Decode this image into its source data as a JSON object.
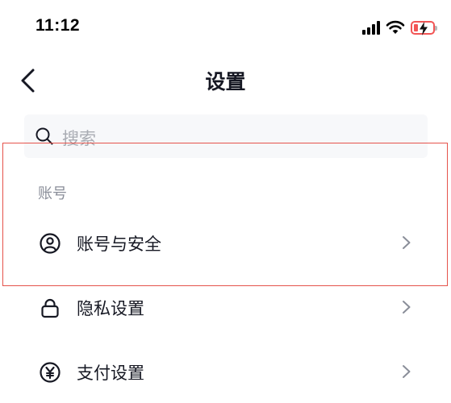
{
  "status_bar": {
    "time": "11:12",
    "icons": [
      "cellular-signal-icon",
      "wifi-icon",
      "battery-charging-icon"
    ],
    "battery_color": "#f25555"
  },
  "nav": {
    "title": "设置",
    "back_icon": "chevron-left-icon"
  },
  "search": {
    "placeholder": "搜索",
    "icon": "search-icon"
  },
  "sections": [
    {
      "header": "账号",
      "items": [
        {
          "label": "账号与安全",
          "icon": "user-circle-icon"
        },
        {
          "label": "隐私设置",
          "icon": "lock-icon"
        },
        {
          "label": "支付设置",
          "icon": "yen-circle-icon"
        }
      ]
    }
  ],
  "colors": {
    "highlight": "#e5534b",
    "text_primary": "#161823",
    "text_secondary": "#8a8e99",
    "search_bg": "#f7f8fa"
  }
}
